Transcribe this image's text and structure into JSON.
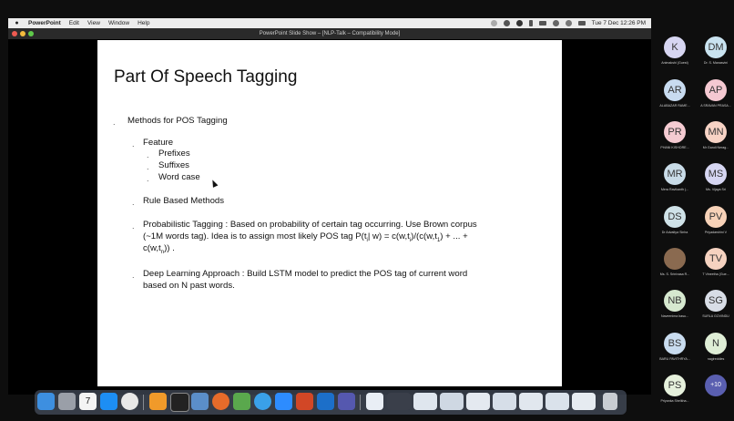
{
  "menubar": {
    "app": "PowerPoint",
    "items": [
      "Edit",
      "View",
      "Window",
      "Help"
    ],
    "clock": "Tue 7 Dec 12:26 PM"
  },
  "window": {
    "title": "PowerPoint Slide Show – [NLP-Talk – Compatibility Mode]"
  },
  "slide": {
    "title": "Part Of Speech Tagging",
    "l1": "Methods for POS Tagging",
    "feature": "Feature",
    "prefixes": "Prefixes",
    "suffixes": "Suffixes",
    "wordcase": "Word case",
    "rule": "Rule Based Methods",
    "prob1": "Probabilistic Tagging : Based on probability of certain tag occurring. Use Brown corpus",
    "prob2a": "(~1M words tag). Idea is to assign most likely POS tag P(t",
    "prob2b": "| w) = c(w,t",
    "prob2c": ")/(c(w,t",
    "prob2d": ") + ... +",
    "prob3a": "c(w,t",
    "prob3b": ")) .",
    "sub_i": "i",
    "sub_1": "1",
    "sub_n": "n",
    "dl1": "Deep Learning Approach : Build LSTM model to predict the POS tag of current word",
    "dl2": "based on N past words.",
    "bullet": "."
  },
  "participants": [
    {
      "initials": "K",
      "name": "Animakshi (Guest)",
      "color": "#d7d6f2"
    },
    {
      "initials": "DM",
      "name": "Dr. S. Manasvini",
      "color": "#c9e3f0"
    },
    {
      "initials": "AR",
      "name": "ALABAZAR RAME...",
      "color": "#c8dbf0"
    },
    {
      "initials": "AP",
      "name": "A SRAVAN PRASA...",
      "color": "#f5c9d2"
    },
    {
      "initials": "PR",
      "name": "PHANI KISHORE...",
      "color": "#f5cbd2"
    },
    {
      "initials": "MN",
      "name": "Mr Gandi Nerag...",
      "color": "#f7d3c5"
    },
    {
      "initials": "MR",
      "name": "Mera Ravikanth (...",
      "color": "#c9dce8"
    },
    {
      "initials": "MS",
      "name": "Ms. Vijaya Sri",
      "color": "#d6d6f2"
    },
    {
      "initials": "DS",
      "name": "Dr Advaitya Sinha",
      "color": "#cfe2e8"
    },
    {
      "initials": "PV",
      "name": "Priyadarshini V",
      "color": "#f7d2b8"
    },
    {
      "initials": "",
      "name": "Ms. S. Srinivasa R...",
      "color": "#8a6a50"
    },
    {
      "initials": "TV",
      "name": "T Vineetha (Gue...",
      "color": "#f5d2c0"
    },
    {
      "initials": "NB",
      "name": "Naveenima basu...",
      "color": "#d6e8cf"
    },
    {
      "initials": "SG",
      "name": "SURLA GOVINDU",
      "color": "#d8dde6"
    },
    {
      "initials": "BS",
      "name": "BARU PAVITHRYA...",
      "color": "#c9dcef"
    },
    {
      "initials": "N",
      "name": "nagireddies",
      "color": "#dfeed6"
    },
    {
      "initials": "PS",
      "name": "Priyanka Shelkha...",
      "color": "#e6f1dc"
    },
    {
      "initials": "+10",
      "name": "",
      "color": "#5a5fb0"
    }
  ],
  "dock": {
    "calendar_day": "7"
  }
}
